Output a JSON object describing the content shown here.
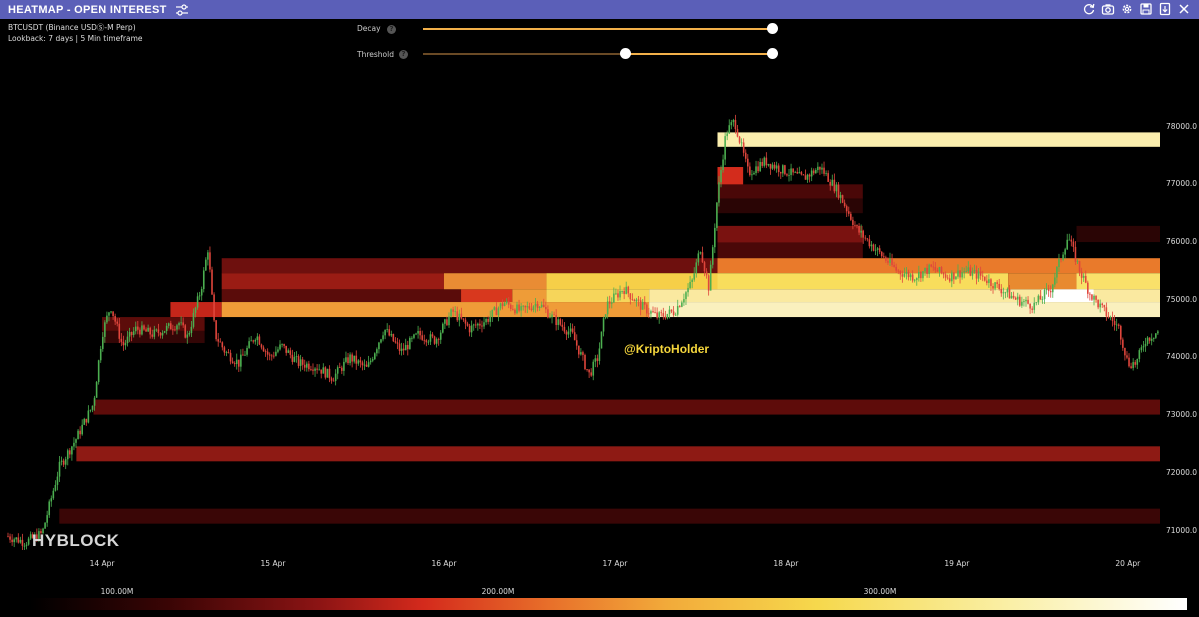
{
  "titlebar": {
    "title": "HEATMAP - OPEN INTEREST",
    "settings_icon": "sliders-icon",
    "toolbar_icons": [
      "refresh-icon",
      "camera-icon",
      "gear-icon",
      "save-icon",
      "download-icon",
      "close-icon"
    ]
  },
  "info": {
    "symbol": "BTCUSDT (Binance USDⓈ-M Perp)",
    "lookback": "Lookback: 7 days | 5 Min timeframe"
  },
  "controls": {
    "decay": {
      "label": "Decay",
      "value": 1.0
    },
    "threshold": {
      "label": "Threshold",
      "low": 0.58,
      "high": 1.0
    }
  },
  "watermark": "@KriptoHolder",
  "logo": "HYBLOCK",
  "colors": {
    "titlebar": "#5b5fb8",
    "slider": "#f2b04a",
    "candle_up": "#4caf50",
    "candle_down": "#e0463c",
    "watermark": "#f5d63c"
  },
  "color_scale": {
    "labels": [
      "100.00M",
      "200.00M",
      "300.00M"
    ]
  },
  "chart_data": {
    "type": "heatmap",
    "title": "",
    "ylim": [
      70750,
      78600
    ],
    "y_ticks": [
      "78000.0",
      "77000.0",
      "76000.0",
      "75000.0",
      "74000.0",
      "73000.0",
      "72000.0",
      "71000.0"
    ],
    "x_ticks": [
      "14 Apr",
      "15 Apr",
      "16 Apr",
      "17 Apr",
      "18 Apr",
      "19 Apr",
      "20 Apr"
    ],
    "x_range_days": [
      13.45,
      20.2
    ],
    "price_path": [
      [
        13.45,
        70900
      ],
      [
        13.55,
        70800
      ],
      [
        13.65,
        70950
      ],
      [
        13.75,
        72100
      ],
      [
        13.85,
        72600
      ],
      [
        13.95,
        73200
      ],
      [
        14.0,
        74400
      ],
      [
        14.05,
        74900
      ],
      [
        14.12,
        74200
      ],
      [
        14.2,
        74500
      ],
      [
        14.3,
        74400
      ],
      [
        14.45,
        74600
      ],
      [
        14.5,
        74350
      ],
      [
        14.58,
        75200
      ],
      [
        14.62,
        75900
      ],
      [
        14.66,
        74400
      ],
      [
        14.72,
        74100
      ],
      [
        14.8,
        73900
      ],
      [
        14.9,
        74400
      ],
      [
        14.98,
        74000
      ],
      [
        15.05,
        74200
      ],
      [
        15.15,
        73900
      ],
      [
        15.25,
        73850
      ],
      [
        15.35,
        73650
      ],
      [
        15.45,
        74000
      ],
      [
        15.55,
        73800
      ],
      [
        15.65,
        74500
      ],
      [
        15.75,
        74100
      ],
      [
        15.85,
        74400
      ],
      [
        15.95,
        74300
      ],
      [
        16.05,
        74800
      ],
      [
        16.15,
        74500
      ],
      [
        16.25,
        74650
      ],
      [
        16.35,
        74950
      ],
      [
        16.45,
        74800
      ],
      [
        16.55,
        74950
      ],
      [
        16.65,
        74650
      ],
      [
        16.75,
        74400
      ],
      [
        16.85,
        73700
      ],
      [
        16.9,
        74000
      ],
      [
        16.95,
        74900
      ],
      [
        17.05,
        75200
      ],
      [
        17.15,
        74900
      ],
      [
        17.25,
        74700
      ],
      [
        17.35,
        74800
      ],
      [
        17.45,
        75300
      ],
      [
        17.5,
        75900
      ],
      [
        17.55,
        75200
      ],
      [
        17.6,
        76800
      ],
      [
        17.65,
        77900
      ],
      [
        17.7,
        78100
      ],
      [
        17.78,
        77200
      ],
      [
        17.88,
        77400
      ],
      [
        17.98,
        77250
      ],
      [
        18.1,
        77100
      ],
      [
        18.2,
        77300
      ],
      [
        18.3,
        76900
      ],
      [
        18.42,
        76200
      ],
      [
        18.55,
        75800
      ],
      [
        18.65,
        75500
      ],
      [
        18.75,
        75400
      ],
      [
        18.85,
        75550
      ],
      [
        18.95,
        75400
      ],
      [
        19.05,
        75500
      ],
      [
        19.15,
        75400
      ],
      [
        19.25,
        75200
      ],
      [
        19.35,
        75000
      ],
      [
        19.45,
        74900
      ],
      [
        19.55,
        75200
      ],
      [
        19.65,
        76100
      ],
      [
        19.72,
        75500
      ],
      [
        19.78,
        75100
      ],
      [
        19.86,
        74800
      ],
      [
        19.95,
        74500
      ],
      [
        20.0,
        73900
      ],
      [
        20.05,
        73900
      ],
      [
        20.1,
        74300
      ],
      [
        20.2,
        74500
      ]
    ],
    "heat_bands": [
      {
        "x0": 17.6,
        "x1": 20.2,
        "y0": 77650,
        "y1": 77900,
        "color": "#fbeeae"
      },
      {
        "x0": 17.6,
        "x1": 17.75,
        "y0": 76950,
        "y1": 77300,
        "color": "#d32c1c"
      },
      {
        "x0": 17.6,
        "x1": 18.45,
        "y0": 76750,
        "y1": 77000,
        "color": "#4a0808"
      },
      {
        "x0": 17.6,
        "x1": 18.45,
        "y0": 76500,
        "y1": 76750,
        "color": "#2a0505"
      },
      {
        "x0": 17.6,
        "x1": 18.45,
        "y0": 75990,
        "y1": 76280,
        "color": "#7a1210"
      },
      {
        "x0": 17.6,
        "x1": 18.45,
        "y0": 75720,
        "y1": 75990,
        "color": "#4a0808"
      },
      {
        "x0": 19.7,
        "x1": 20.2,
        "y0": 76000,
        "y1": 76280,
        "color": "#2a0505"
      },
      {
        "x0": 14.7,
        "x1": 17.6,
        "y0": 75460,
        "y1": 75720,
        "color": "#6e100e"
      },
      {
        "x0": 17.6,
        "x1": 20.2,
        "y0": 75460,
        "y1": 75720,
        "color": "#e97a2b"
      },
      {
        "x0": 14.7,
        "x1": 16.0,
        "y0": 75180,
        "y1": 75460,
        "color": "#9a1c14"
      },
      {
        "x0": 16.0,
        "x1": 16.6,
        "y0": 75180,
        "y1": 75460,
        "color": "#e98c34"
      },
      {
        "x0": 16.6,
        "x1": 17.6,
        "y0": 75180,
        "y1": 75460,
        "color": "#f6cf48"
      },
      {
        "x0": 17.6,
        "x1": 19.3,
        "y0": 75180,
        "y1": 75460,
        "color": "#f8dd5c"
      },
      {
        "x0": 19.3,
        "x1": 19.7,
        "y0": 75180,
        "y1": 75460,
        "color": "#e88a30"
      },
      {
        "x0": 19.7,
        "x1": 20.2,
        "y0": 75180,
        "y1": 75460,
        "color": "#f9e06a"
      },
      {
        "x0": 14.7,
        "x1": 16.1,
        "y0": 74960,
        "y1": 75180,
        "color": "#5a0c0a"
      },
      {
        "x0": 16.1,
        "x1": 16.4,
        "y0": 74960,
        "y1": 75180,
        "color": "#d8381e"
      },
      {
        "x0": 16.4,
        "x1": 16.6,
        "y0": 74960,
        "y1": 75180,
        "color": "#ee9c38"
      },
      {
        "x0": 16.6,
        "x1": 17.2,
        "y0": 74960,
        "y1": 75180,
        "color": "#f6d55a"
      },
      {
        "x0": 17.2,
        "x1": 20.2,
        "y0": 74960,
        "y1": 75180,
        "color": "#fae9a0"
      },
      {
        "x0": 19.5,
        "x1": 19.8,
        "y0": 74960,
        "y1": 75180,
        "color": "#ffffff"
      },
      {
        "x0": 14.4,
        "x1": 14.7,
        "y0": 74700,
        "y1": 74960,
        "color": "#c4261a"
      },
      {
        "x0": 14.7,
        "x1": 17.2,
        "y0": 74700,
        "y1": 74960,
        "color": "#ef9c38"
      },
      {
        "x0": 17.2,
        "x1": 20.2,
        "y0": 74700,
        "y1": 74960,
        "color": "#faf0be"
      },
      {
        "x0": 14.0,
        "x1": 14.6,
        "y0": 74460,
        "y1": 74700,
        "color": "#5c0c0a"
      },
      {
        "x0": 14.0,
        "x1": 14.6,
        "y0": 74250,
        "y1": 74460,
        "color": "#330606"
      },
      {
        "x0": 13.95,
        "x1": 20.2,
        "y0": 73010,
        "y1": 73270,
        "color": "#5e0c0a"
      },
      {
        "x0": 13.85,
        "x1": 20.2,
        "y0": 72200,
        "y1": 72460,
        "color": "#8e1a14"
      },
      {
        "x0": 13.75,
        "x1": 20.2,
        "y0": 71120,
        "y1": 71380,
        "color": "#3a0606"
      }
    ]
  }
}
